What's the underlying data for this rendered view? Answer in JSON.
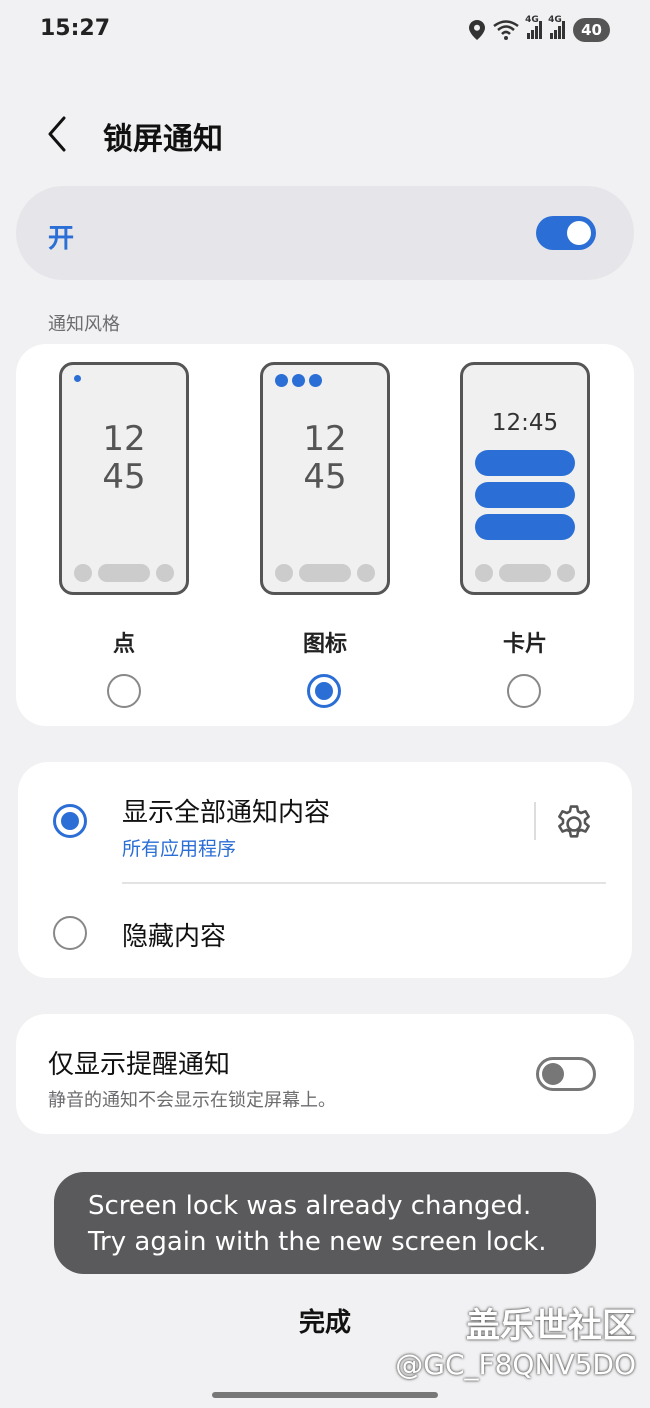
{
  "status_bar": {
    "time": "15:27",
    "sim1_tag": "4G",
    "sim2_tag": "4G",
    "battery": "40",
    "icons": [
      "location-icon",
      "wifi-icon",
      "signal-icon",
      "signal-icon",
      "battery-icon"
    ]
  },
  "header": {
    "back_icon": "chevron-left-icon",
    "title": "锁屏通知"
  },
  "master_switch": {
    "label": "开",
    "state": "on"
  },
  "notification_style": {
    "section_label": "通知风格",
    "options": [
      {
        "label": "点",
        "clock_hour": "12",
        "clock_min": "45",
        "selected": false
      },
      {
        "label": "图标",
        "clock_hour": "12",
        "clock_min": "45",
        "selected": true
      },
      {
        "label": "卡片",
        "clock": "12:45",
        "selected": false
      }
    ]
  },
  "content_options": {
    "show_all": {
      "title": "显示全部通知内容",
      "subtitle": "所有应用程序",
      "selected": true,
      "settings_icon": "gear-icon"
    },
    "hide": {
      "title": "隐藏内容",
      "selected": false
    }
  },
  "alerts_only": {
    "title": "仅显示提醒通知",
    "subtitle": "静音的通知不会显示在锁定屏幕上。",
    "state": "off"
  },
  "toast": {
    "message": "Screen lock was already changed. Try again with the new screen lock."
  },
  "footer": {
    "done_label": "完成"
  },
  "watermark": {
    "line1": "盖乐世社区",
    "line2": "@GC_F8QNV5DO"
  },
  "colors": {
    "accent": "#2b6fd6",
    "background": "#f1f1f3",
    "toast_bg": "#5a5a5c"
  }
}
